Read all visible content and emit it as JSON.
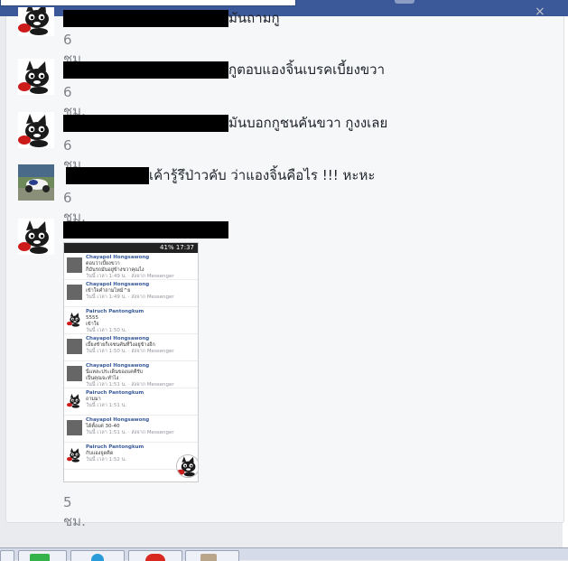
{
  "comments": [
    {
      "text": "มันถามกู",
      "time": "6 ชม.",
      "redact_width": 183
    },
    {
      "text": "กูตอบแองจิ้นเบรคเบี้ยงขวา",
      "time": "6 ชม.",
      "redact_width": 183
    },
    {
      "text": "มันบอกกูชนคันขวา กูงงเลย",
      "time": "6 ชม.",
      "redact_width": 183
    },
    {
      "text": "เค้ารู้รึป่าวคับ ว่าแองจิ้นคือไร !!! หะหะ",
      "time": "6 ชม.",
      "redact_width": 92
    },
    {
      "text": "",
      "time": "5 ชม.",
      "redact_width": 183
    }
  ],
  "attachment": {
    "status_bar": "41% 17:37",
    "messages": [
      {
        "name": "Chayapol Hongsawong",
        "line1": "ตอบว่าเบี้ยงขวา",
        "line2": "ก็มันรถมันอยู่ข้างขวาคุณไง",
        "meta": "วันนี้ เวลา 1:49 น. · ส่งจาก Messenger",
        "avatar": "photo"
      },
      {
        "name": "Chayapol Hongsawong",
        "line1": "เข้าใจคำถามไหม้^ย",
        "line2": "",
        "meta": "วันนี้ เวลา 1:49 น. · ส่งจาก Messenger",
        "avatar": "photo"
      },
      {
        "name": "Pairuch Pantongkum",
        "line1": "5555",
        "line2": "เข้าใจ",
        "meta": "วันนี้ เวลา 1:50 น.",
        "avatar": "cat"
      },
      {
        "name": "Chayapol Hongsawong",
        "line1": "เบี้ยงซ้ายก็เจชนคันที่วิ่งอยู่ข้างอีก",
        "line2": "",
        "meta": "วันนี้ เวลา 1:50 น. · ส่งจาก Messenger",
        "avatar": "photo"
      },
      {
        "name": "Chayapol Hongsawong",
        "line1": "นี่แหละประเด็นของแคคีรับ",
        "line2": "เป็นคุณจะทำไง",
        "meta": "วันนี้ เวลา 1:51 น. · ส่งจาก Messenger",
        "avatar": "photo"
      },
      {
        "name": "Pairuch Pantongkum",
        "line1": "ถามมา",
        "line2": "",
        "meta": "วันนี้ เวลา 1:51 น.",
        "avatar": "cat"
      },
      {
        "name": "Chayapol Hongsawong",
        "line1": "ได้ตั้งแต่ 30-40",
        "line2": "",
        "meta": "วันนี้ เวลา 1:51 น. · ส่งจาก Messenger",
        "avatar": "photo"
      },
      {
        "name": "Pairuch Pantongkum",
        "line1": "กับแองจูดคิด",
        "line2": "",
        "meta": "วันนี้ เวลา 1:52 น.",
        "avatar": "cat"
      }
    ]
  },
  "icons": {
    "close": "×"
  },
  "colors": {
    "topbar": "#3b5998",
    "time": "#7f8289",
    "name_link": "#365899"
  }
}
